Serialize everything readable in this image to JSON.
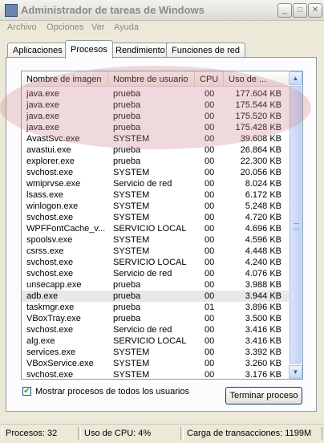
{
  "window": {
    "title": "Administrador de tareas de Windows"
  },
  "window_buttons": {
    "minimize": "_",
    "maximize": "□",
    "close": "✕"
  },
  "menu": [
    "Archivo",
    "Opciones",
    "Ver",
    "Ayuda"
  ],
  "tabs": [
    "Aplicaciones",
    "Procesos",
    "Rendimiento",
    "Funciones de red"
  ],
  "active_tab": "Procesos",
  "columns": [
    "Nombre de imagen",
    "Nombre de usuario",
    "CPU",
    "Uso de ..."
  ],
  "processes": [
    {
      "image": "java.exe",
      "user": "prueba",
      "cpu": "00",
      "mem": "177.604 KB"
    },
    {
      "image": "java.exe",
      "user": "prueba",
      "cpu": "00",
      "mem": "175.544 KB"
    },
    {
      "image": "java.exe",
      "user": "prueba",
      "cpu": "00",
      "mem": "175.520 KB"
    },
    {
      "image": "java.exe",
      "user": "prueba",
      "cpu": "00",
      "mem": "175.428 KB"
    },
    {
      "image": "AvastSvc.exe",
      "user": "SYSTEM",
      "cpu": "00",
      "mem": "39.608 KB"
    },
    {
      "image": "avastui.exe",
      "user": "prueba",
      "cpu": "00",
      "mem": "26.864 KB"
    },
    {
      "image": "explorer.exe",
      "user": "prueba",
      "cpu": "00",
      "mem": "22.300 KB"
    },
    {
      "image": "svchost.exe",
      "user": "SYSTEM",
      "cpu": "00",
      "mem": "20.056 KB"
    },
    {
      "image": "wmiprvse.exe",
      "user": "Servicio de red",
      "cpu": "00",
      "mem": "8.024 KB"
    },
    {
      "image": "lsass.exe",
      "user": "SYSTEM",
      "cpu": "00",
      "mem": "6.172 KB"
    },
    {
      "image": "winlogon.exe",
      "user": "SYSTEM",
      "cpu": "00",
      "mem": "5.248 KB"
    },
    {
      "image": "svchost.exe",
      "user": "SYSTEM",
      "cpu": "00",
      "mem": "4.720 KB"
    },
    {
      "image": "WPFFontCache_v...",
      "user": "SERVICIO LOCAL",
      "cpu": "00",
      "mem": "4.696 KB"
    },
    {
      "image": "spoolsv.exe",
      "user": "SYSTEM",
      "cpu": "00",
      "mem": "4.596 KB"
    },
    {
      "image": "csrss.exe",
      "user": "SYSTEM",
      "cpu": "00",
      "mem": "4.448 KB"
    },
    {
      "image": "svchost.exe",
      "user": "SERVICIO LOCAL",
      "cpu": "00",
      "mem": "4.240 KB"
    },
    {
      "image": "svchost.exe",
      "user": "Servicio de red",
      "cpu": "00",
      "mem": "4.076 KB"
    },
    {
      "image": "unsecapp.exe",
      "user": "prueba",
      "cpu": "00",
      "mem": "3.988 KB"
    },
    {
      "image": "adb.exe",
      "user": "prueba",
      "cpu": "00",
      "mem": "3.944 KB"
    },
    {
      "image": "taskmgr.exe",
      "user": "prueba",
      "cpu": "01",
      "mem": "3.896 KB"
    },
    {
      "image": "VBoxTray.exe",
      "user": "prueba",
      "cpu": "00",
      "mem": "3.500 KB"
    },
    {
      "image": "svchost.exe",
      "user": "Servicio de red",
      "cpu": "00",
      "mem": "3.416 KB"
    },
    {
      "image": "alg.exe",
      "user": "SERVICIO LOCAL",
      "cpu": "00",
      "mem": "3.416 KB"
    },
    {
      "image": "services.exe",
      "user": "SYSTEM",
      "cpu": "00",
      "mem": "3.392 KB"
    },
    {
      "image": "VBoxService.exe",
      "user": "SYSTEM",
      "cpu": "00",
      "mem": "3.260 KB"
    },
    {
      "image": "svchost.exe",
      "user": "SYSTEM",
      "cpu": "00",
      "mem": "3.176 KB"
    }
  ],
  "show_all_users": {
    "label": "Mostrar procesos de todos los usuarios",
    "checked": true,
    "mark": "✔"
  },
  "end_process_label": "Terminar proceso",
  "status": {
    "processes": "Procesos: 32",
    "cpu": "Uso de CPU: 4%",
    "commit": "Carga de transacciones: 1199M"
  },
  "scroll_arrows": {
    "up": "▲",
    "down": "▼"
  },
  "colors": {
    "highlight": "#cd828c",
    "list_border": "#7f9db9",
    "button_border": "#003c74"
  }
}
